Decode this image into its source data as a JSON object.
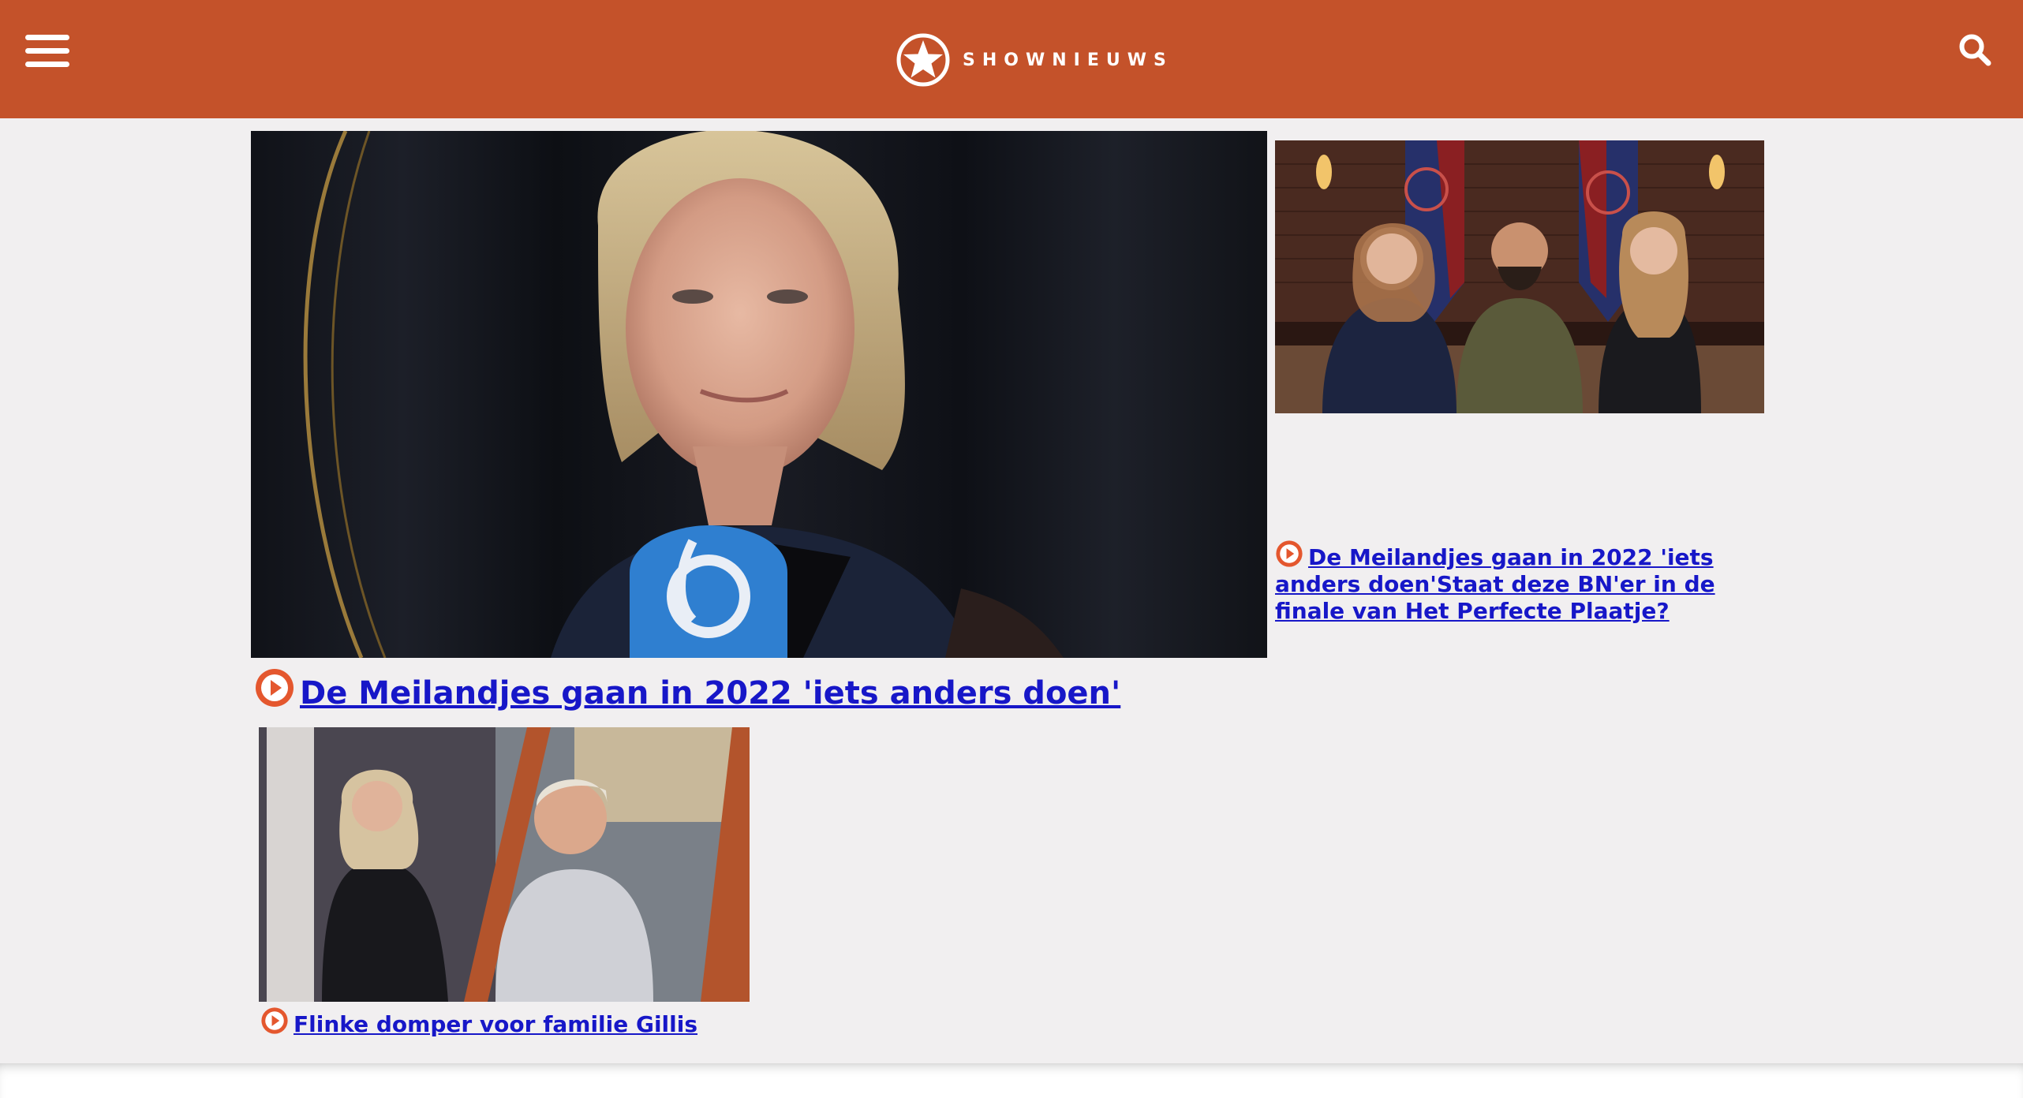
{
  "header": {
    "brand": "SHOWNIEUWS",
    "icons": {
      "menu": "hamburger-menu-icon",
      "search": "search-icon",
      "logo": "star-logo-icon"
    }
  },
  "articles": {
    "main": {
      "title": "De Meilandjes gaan in 2022 'iets anders doen'",
      "icon": "play-icon"
    },
    "side": {
      "title": "De Meilandjes gaan in 2022 'iets anders doen'Staat deze BN'er in de finale van Het Perfecte Plaatje?",
      "icon": "play-icon"
    },
    "bottom": {
      "title": "Flinke domper voor familie Gillis",
      "icon": "play-icon"
    }
  },
  "colors": {
    "header_bg": "#c4522a",
    "page_bg": "#f1eff0",
    "link": "#1717c8",
    "play_icon": "#e4572e"
  }
}
